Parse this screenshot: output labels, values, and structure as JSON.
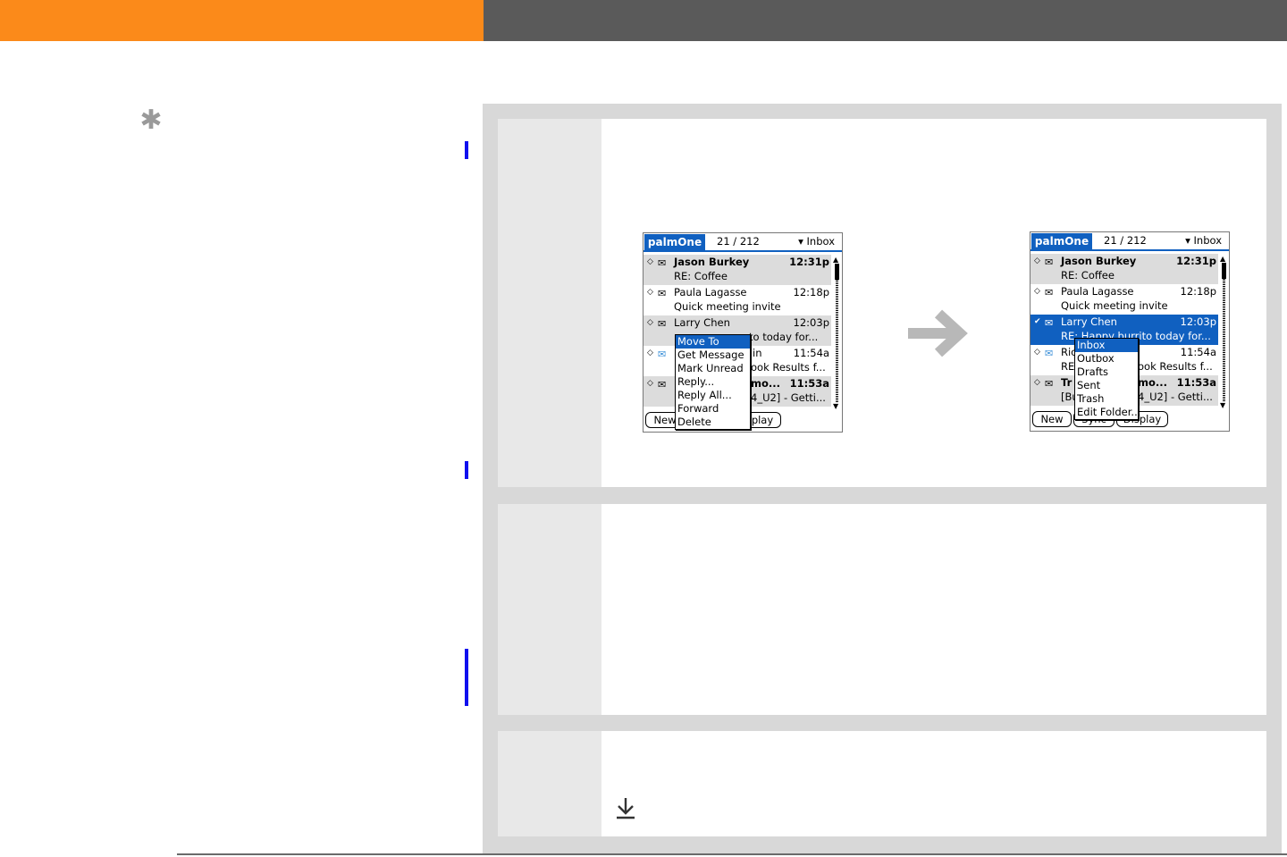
{
  "palm_left": {
    "logo": "palmOne",
    "count": "21 / 212",
    "folder": "Inbox",
    "messages": [
      {
        "sender": "Jason Burkey",
        "time": "12:31p",
        "subject": "RE: Coffee"
      },
      {
        "sender": "Paula Lagasse",
        "time": "12:18p",
        "subject": "Quick meeting invite"
      },
      {
        "sender": "Larry Chen",
        "time": "12:03p",
        "subject": "to today for..."
      },
      {
        "sender": "in",
        "time": "11:54a",
        "subject": "ook Results f..."
      },
      {
        "sender": "mo...",
        "time": "11:53a",
        "subject": "4_U2] - Getti..."
      }
    ],
    "buttons": {
      "new": "New",
      "display": "play"
    },
    "menu": [
      "Move To",
      "Get Message",
      "Mark Unread",
      "Reply...",
      "Reply All...",
      "Forward",
      "Delete"
    ]
  },
  "palm_right": {
    "logo": "palmOne",
    "count": "21 / 212",
    "folder": "Inbox",
    "messages": [
      {
        "sender": "Jason Burkey",
        "time": "12:31p",
        "subject": "RE: Coffee"
      },
      {
        "sender": "Paula Lagasse",
        "time": "12:18p",
        "subject": "Quick meeting invite"
      },
      {
        "sender": "Larry Chen",
        "time": "12:03p",
        "subject": "RE: Happy burrito today for..."
      },
      {
        "sender": "Ric",
        "time": "11:54a",
        "subject": "RE:",
        "subject_tail": "ook Results f..."
      },
      {
        "sender": "Tr",
        "sender_tail": "mo...",
        "time": "11:53a",
        "subject": "[Bu",
        "subject_tail": "4_U2] - Getti..."
      }
    ],
    "buttons": {
      "new": "New",
      "sync": "Sync",
      "display": "Display"
    },
    "menu": [
      "Inbox",
      "Outbox",
      "Drafts",
      "Sent",
      "Trash",
      "Edit Folder..."
    ]
  },
  "icons": {
    "tip": "asterisk-icon",
    "arrow": "right-arrow-icon",
    "download": "down-arrow-icon"
  }
}
